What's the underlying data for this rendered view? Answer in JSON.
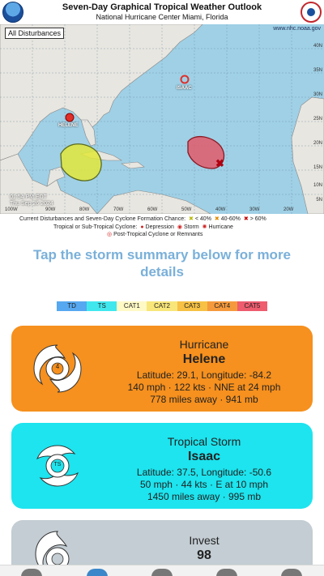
{
  "map": {
    "title": "Seven-Day Graphical Tropical Weather Outlook",
    "subtitle": "National Hurricane Center  Miami, Florida",
    "badge": "All Disturbances",
    "site_url": "www.nhc.noaa.gov",
    "date_line1": "01:54 PM EDT",
    "date_line2": "Thu Sep 26 2024",
    "storm_labels": [
      "HELENE",
      "ISAAC"
    ],
    "lon_labels": [
      "100W",
      "90W",
      "80W",
      "70W",
      "60W",
      "50W",
      "40W",
      "30W",
      "20W"
    ],
    "lat_labels": [
      "40N",
      "35N",
      "30N",
      "25N",
      "20N",
      "15N",
      "10N",
      "5N"
    ],
    "legend": {
      "line1": "Current Disturbances and Seven-Day Cyclone Formation Chance:",
      "low": "< 40%",
      "medium": "40-60%",
      "high": "> 60%",
      "line2_label": "Tropical or Sub-Tropical Cyclone:",
      "depression": "Depression",
      "storm": "Storm",
      "hurricane": "Hurricane",
      "line3": "Post-Tropical Cyclone or Remnants"
    }
  },
  "instruction": "Tap the storm summary below for more details",
  "scale": [
    {
      "label": "TD",
      "color": "#56a8f0"
    },
    {
      "label": "TS",
      "color": "#40e8ee"
    },
    {
      "label": "CAT1",
      "color": "#fff9c6"
    },
    {
      "label": "CAT2",
      "color": "#f8e67a"
    },
    {
      "label": "CAT3",
      "color": "#f6c144"
    },
    {
      "label": "CAT4",
      "color": "#f59a3c"
    },
    {
      "label": "CAT5",
      "color": "#ee5c6e"
    }
  ],
  "storms": [
    {
      "type": "Hurricane",
      "name": "Helene",
      "position": "Latitude: 29.1, Longitude: -84.2",
      "wind": "140 mph · 122 kts · NNE at 24 mph",
      "distance": "778 miles away · 941 mb",
      "icon_text": "4",
      "color": "#f6901e",
      "icon": "hurricane-symbol-icon"
    },
    {
      "type": "Tropical Storm",
      "name": "Isaac",
      "position": "Latitude: 37.5, Longitude: -50.6",
      "wind": "50 mph · 44 kts · E at 10 mph",
      "distance": "1450 miles away · 995 mb",
      "icon_text": "TS",
      "color": "#1de4ee",
      "icon": "tropical-storm-symbol-icon"
    },
    {
      "type": "Invest",
      "name": "98",
      "color": "#c3cdd3",
      "icon": "invest-symbol-icon"
    }
  ],
  "tabbar": {
    "tabs": [
      "map-tab",
      "radar-tab",
      "storms-tab",
      "satellite-tab",
      "settings-tab"
    ]
  }
}
